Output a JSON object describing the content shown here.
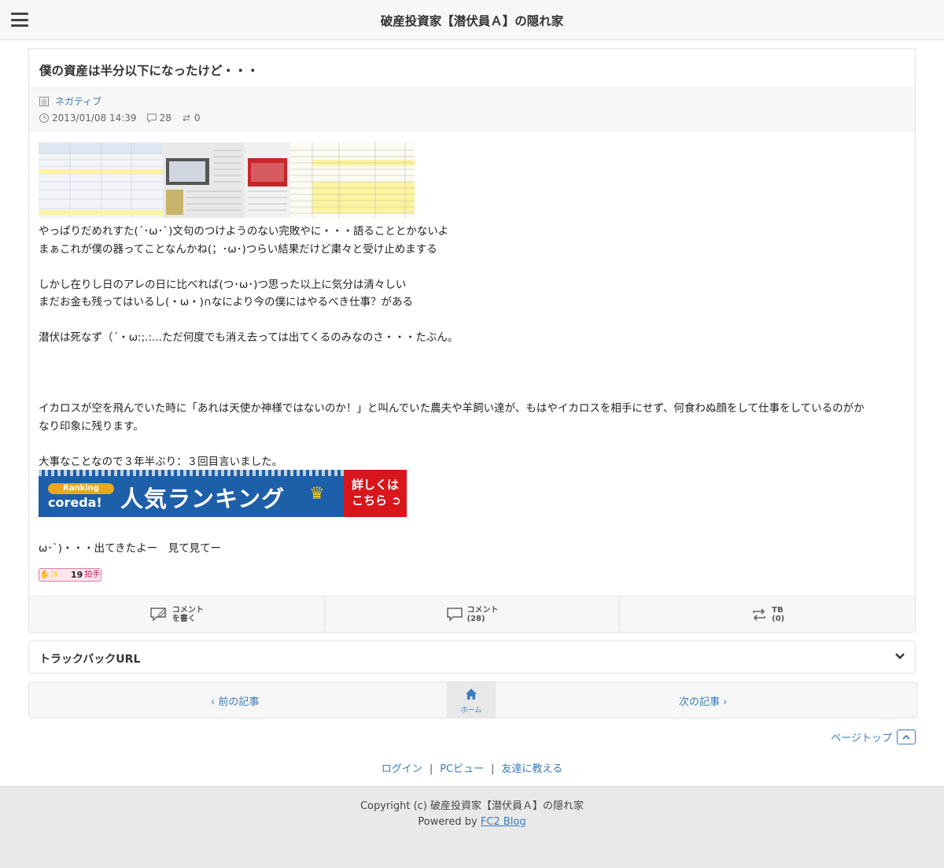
{
  "header": {
    "site_title": "破産投資家【潜伏員Ａ】の隠れ家"
  },
  "entry": {
    "title": "僕の資産は半分以下になったけど・・・",
    "category": "ネガティブ",
    "datetime": "2013/01/08 14:39",
    "comment_count": "28",
    "trackback_count": "0",
    "body_lines": [
      "やっぱりだめれすた(´･ω･`)文句のつけようのない完敗やに・・・語ることとかないよ",
      "まぁこれが僕の器ってことなんかね(；･ω･)つらい結果だけど粛々と受け止めまする",
      "",
      "しかし在りし日のアレの日に比べれば(つ･ω･)つ思った以上に気分は清々しい",
      "まだお金も残ってはいるし(・ω・)∩なにより今の僕にはやるべき仕事？がある",
      "",
      "潜伏は死なず（´・ω:;.:...ただ何度でも消え去っては出てくるのみなのさ・・・たぶん。",
      "",
      "",
      "",
      "イカロスが空を飛んでいた時に「あれは天使か神様ではないのか！」と叫んでいた農夫や羊飼い達が、もはやイカロスを相手にせず、何食わぬ顔をして仕事をしているのがか",
      "なり印象に残ります。",
      "",
      "大事なことなので３年半ぶり：３回目言いました。"
    ],
    "tail_line": "ω･`)・・・出てきたよー　見て見てー",
    "banner": {
      "ranking_label": "Ranking",
      "coreda": "coreda!",
      "main": "人気ランキング",
      "cta_line1": "詳しくは",
      "cta_line2": "こちら"
    },
    "clap": {
      "count": "19",
      "label": "拍手"
    }
  },
  "actions": {
    "write_comment": [
      "コメント",
      "を書く"
    ],
    "comments": [
      "コメント",
      "(28)"
    ],
    "tb": [
      "TB",
      "(0)"
    ]
  },
  "trackback_url_label": "トラックバックURL",
  "pager": {
    "prev": "前の記事",
    "home": "ホーム",
    "next": "次の記事"
  },
  "pagetop_label": "ページトップ",
  "footer_links": {
    "login": "ログイン",
    "pc_view": "PCビュー",
    "tell_friend": "友達に教える"
  },
  "footer": {
    "copyright": "Copyright (c) 破産投資家【潜伏員Ａ】の隠れ家",
    "powered_by": "Powered by ",
    "fc2": "FC2 Blog"
  },
  "colors": {
    "link": "#3a7cc1",
    "banner_blue": "#1d5fa8",
    "banner_red": "#d8161b"
  }
}
